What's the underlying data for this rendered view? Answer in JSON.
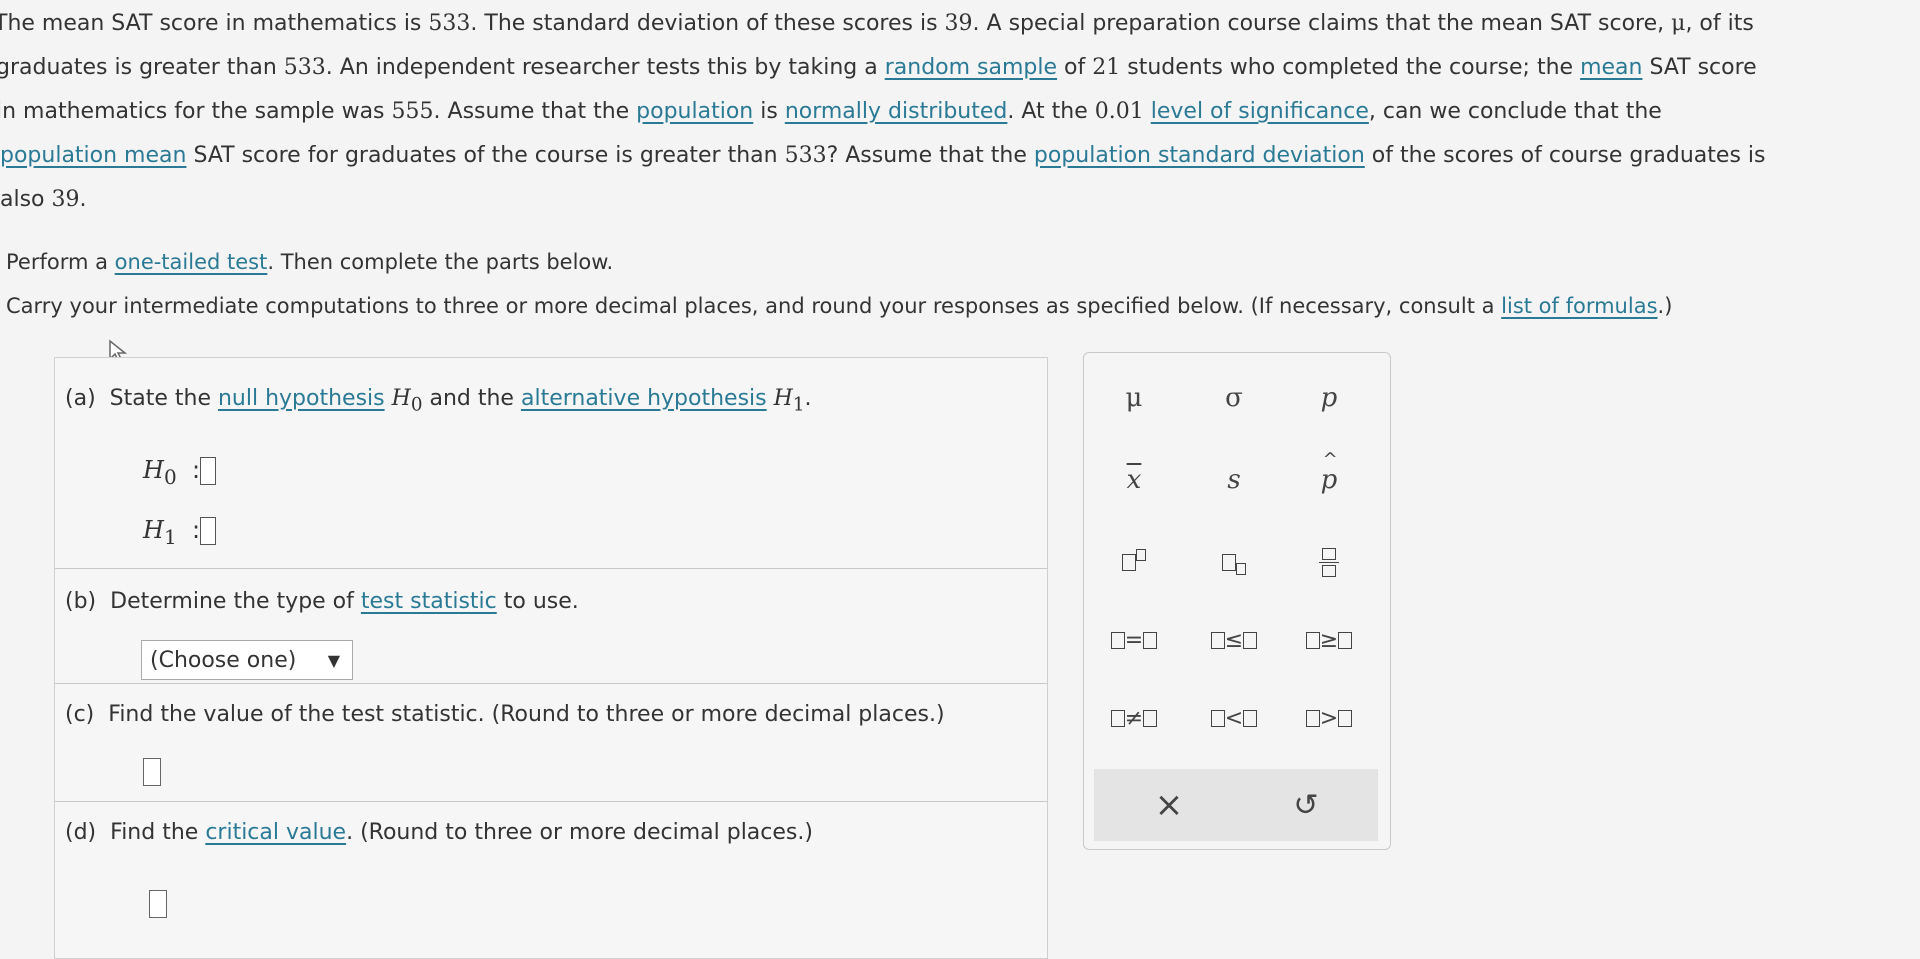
{
  "problem": {
    "line1": {
      "a": "The mean SAT score in mathematics is ",
      "n1": "533",
      "b": ". The standard deviation of these scores is ",
      "n2": "39",
      "c": ". A special preparation course claims that the mean SAT score, ",
      "mu": "μ",
      "d": ", of its"
    },
    "line2": {
      "a": "graduates is greater than ",
      "n1": "533",
      "b": ". An independent researcher tests this by taking a ",
      "link1": "random sample",
      "c": " of ",
      "n2": "21",
      "d": " students who completed the course; the ",
      "link2": "mean",
      "e": " SAT score"
    },
    "line3": {
      "a": "in mathematics for the sample was ",
      "n1": "555",
      "b": ". Assume that the ",
      "link1": "population",
      "c": " is ",
      "link2": "normally distributed",
      "d": ". At the ",
      "n2": "0.01",
      "e": " ",
      "link3": "level of significance",
      "f": ", can we conclude that the"
    },
    "line4": {
      "link1": "population mean",
      "a": " SAT score for graduates of the course is greater than ",
      "n1": "533",
      "b": "? Assume that the ",
      "link2": "population standard deviation",
      "c": " of the scores of course graduates is"
    },
    "line5": {
      "a": "also ",
      "n1": "39",
      "b": "."
    },
    "perform": {
      "a": "Perform a ",
      "link": "one-tailed test",
      "b": ". Then complete the parts below."
    },
    "carry": {
      "a": "Carry your intermediate computations to three or more decimal places, and round your responses as specified below. (If necessary, consult a ",
      "link": "list of formulas",
      "b": ".)"
    }
  },
  "part_a": {
    "label": "(a)",
    "t1": "State the ",
    "link1": "null hypothesis",
    "h0": "H",
    "h0sub": "0",
    "t2": " and the ",
    "link2": "alternative hypothesis",
    "h1": "H",
    "h1sub": "1",
    "t3": ".",
    "h0_label": "H",
    "h0_label_sub": "0",
    "h1_label": "H",
    "h1_label_sub": "1",
    "colon": ":"
  },
  "part_b": {
    "label": "(b)",
    "t1": "Determine the type of ",
    "link": "test statistic",
    "t2": " to use.",
    "dropdown_value": "(Choose one)",
    "dropdown_arrow": "▼"
  },
  "part_c": {
    "label": "(c)",
    "text": "Find the value of the test statistic. (Round to three or more decimal places.)"
  },
  "part_d": {
    "label": "(d)",
    "t1": "Find the ",
    "link": "critical value",
    "t2": ". (Round to three or more decimal places.)"
  },
  "palette": {
    "mu": "μ",
    "sigma": "σ",
    "p": "p",
    "xbar": "x",
    "s": "s",
    "phat": "p",
    "eq": "=",
    "le": "≤",
    "ge": "≥",
    "ne": "≠",
    "lt": "<",
    "gt": ">",
    "clear": "×",
    "undo": "↺"
  }
}
